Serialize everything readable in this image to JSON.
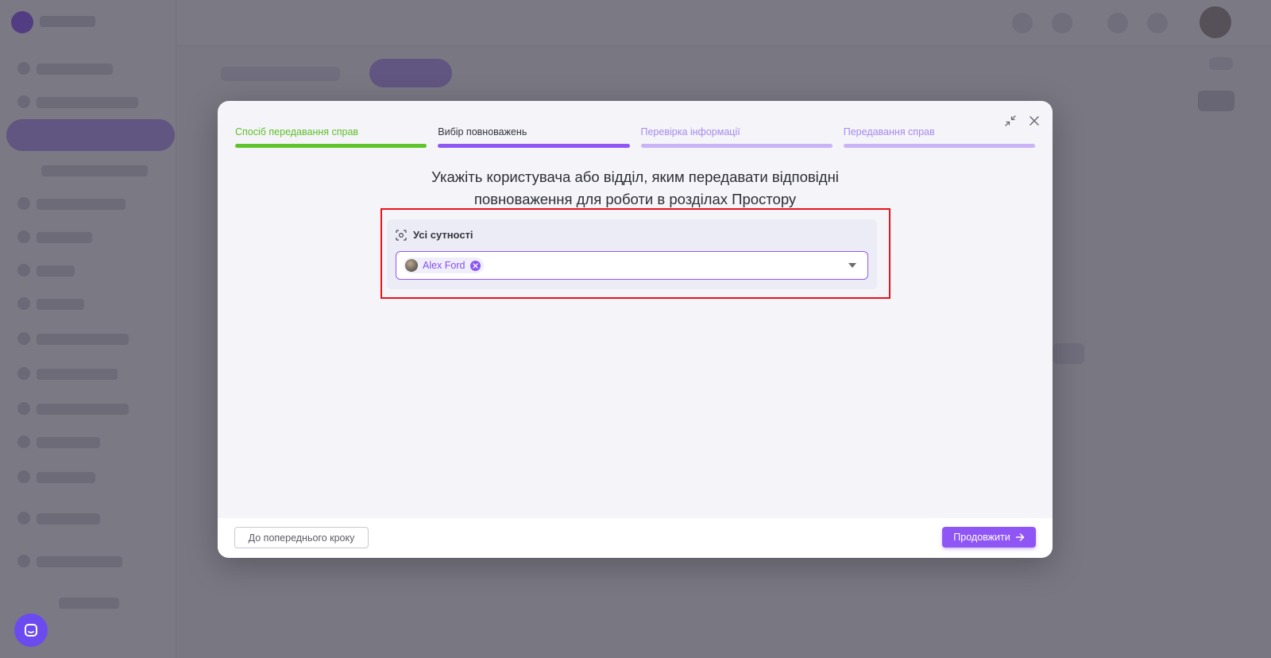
{
  "wizard": {
    "steps": [
      {
        "label": "Спосіб передавання справ",
        "state": "done"
      },
      {
        "label": "Вибір повноважень",
        "state": "active"
      },
      {
        "label": "Перевірка інформації",
        "state": "pending"
      },
      {
        "label": "Передавання справ",
        "state": "pending"
      }
    ],
    "title_line1": "Укажіть користувача або відділ, яким передавати відповідні",
    "title_line2": "повноваження для роботи в розділах Простору",
    "entity_section": {
      "label": "Усі сутності",
      "icon": "scan-focus-icon",
      "selected": [
        {
          "name": "Alex Ford"
        }
      ]
    },
    "footer": {
      "back_label": "До попереднього кроку",
      "next_label": "Продовжити"
    }
  },
  "colors": {
    "accent": "#9157f5",
    "done": "#5fc42b",
    "pending": "#c8b4f6",
    "highlight": "#e8131b"
  }
}
